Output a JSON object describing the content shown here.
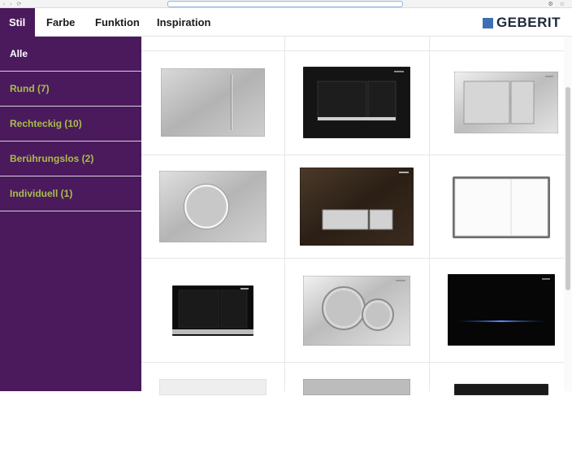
{
  "browser": {
    "url_text": ""
  },
  "nav": {
    "tabs": [
      {
        "label": "Stil",
        "active": true
      },
      {
        "label": "Farbe",
        "active": false
      },
      {
        "label": "Funktion",
        "active": false
      },
      {
        "label": "Inspiration",
        "active": false
      }
    ],
    "logo": "GEBERIT"
  },
  "sidebar": {
    "items": [
      {
        "label": "Alle",
        "active": true
      },
      {
        "label": "Rund (7)",
        "active": false
      },
      {
        "label": "Rechteckig (10)",
        "active": false
      },
      {
        "label": "Berührungslos (2)",
        "active": false
      },
      {
        "label": "Individuell (1)",
        "active": false
      }
    ]
  },
  "colors": {
    "brand_purple": "#4a1a5c",
    "accent_green": "#a9bd4d",
    "logo_blue": "#3d6fb6"
  },
  "products": [
    {
      "name": "brushed-steel-plate-slim-bar"
    },
    {
      "name": "black-plate-dual-button"
    },
    {
      "name": "chrome-plate-dual-button"
    },
    {
      "name": "steel-plate-round-ring"
    },
    {
      "name": "brown-glass-plate-bar-button"
    },
    {
      "name": "white-glass-plate-dual-button"
    },
    {
      "name": "black-glass-plate-small"
    },
    {
      "name": "chrome-plate-double-circle"
    },
    {
      "name": "black-glass-plate-touchless"
    },
    {
      "name": "partial-plate-4"
    },
    {
      "name": "partial-plate-5"
    },
    {
      "name": "partial-plate-6"
    }
  ]
}
